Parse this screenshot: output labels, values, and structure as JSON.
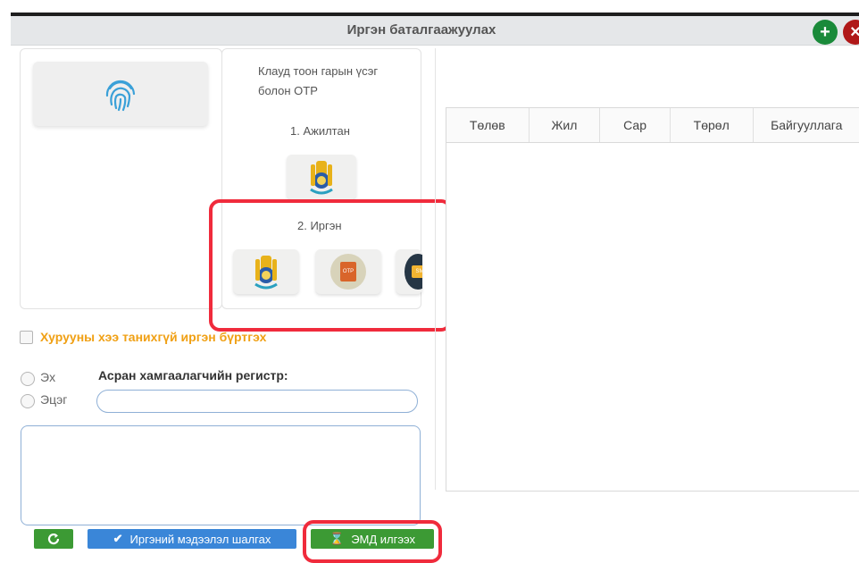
{
  "window": {
    "title": "Иргэн баталгаажуулах",
    "add_glyph": "+",
    "close_glyph": "×"
  },
  "auth_options": {
    "fingerprint_icon": "fingerprint-icon",
    "cloud_text_line1": "Клауд тоон гарын үсэг",
    "cloud_text_line2": "болон OTP",
    "step1": "1. Ажилтан",
    "step2": "2. Иргэн",
    "otp_badge": "OTP",
    "sms_badge": "SMS"
  },
  "table": {
    "columns": [
      "Төлөв",
      "Жил",
      "Сар",
      "Төрөл",
      "Байгууллага"
    ]
  },
  "form": {
    "no_fingerprint_label": "Хурууны хээ танихгүй иргэн бүртгэх",
    "radio_mother": "Эх",
    "radio_father": "Эцэг",
    "guardian_label": "Асран хамгаалагчийн регистр:",
    "guardian_value": ""
  },
  "actions": {
    "refresh_icon": "refresh-icon",
    "check_label": "Иргэний мэдээлэл шалгах",
    "check_glyph": "✔",
    "send_label": "ЭМД илгээх",
    "send_glyph": "⌛"
  },
  "colors": {
    "accent_green": "#3c9a34",
    "accent_blue": "#3a86d8",
    "highlight_red": "#f02b3c",
    "warning_orange": "#f0a014"
  }
}
